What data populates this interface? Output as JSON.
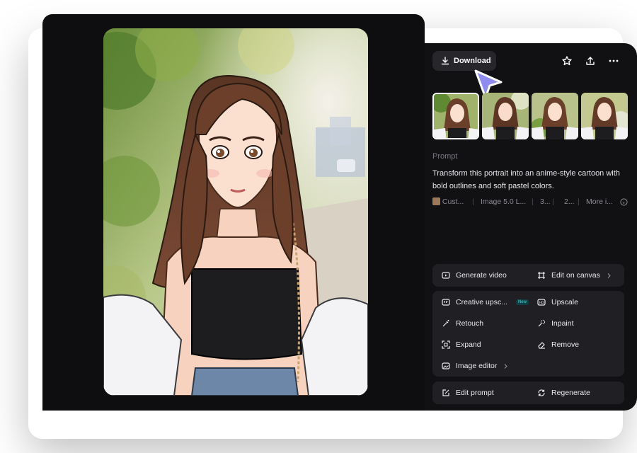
{
  "toolbar": {
    "download_label": "Download",
    "icons": [
      "download-icon",
      "star-icon",
      "share-icon",
      "more-icon"
    ]
  },
  "thumbnails": {
    "count": 4,
    "selected_index": 0
  },
  "prompt": {
    "label": "Prompt",
    "text": "Transform this portrait into an anime-style cartoon with bold outlines and soft pastel colors.",
    "meta": [
      "Cust...",
      "Image 5.0 L...",
      "3...",
      "2...",
      "More i..."
    ]
  },
  "actions": {
    "group1": [
      {
        "label": "Generate video",
        "icon": "video-icon"
      },
      {
        "label": "Edit on canvas",
        "icon": "canvas-icon"
      }
    ],
    "group2": [
      {
        "label": "Creative upsc...",
        "icon": "creative-upscale-icon",
        "badge": "New"
      },
      {
        "label": "Upscale",
        "icon": "upscale-icon"
      },
      {
        "label": "Retouch",
        "icon": "retouch-icon"
      },
      {
        "label": "Inpaint",
        "icon": "inpaint-icon"
      },
      {
        "label": "Expand",
        "icon": "expand-icon"
      },
      {
        "label": "Remove",
        "icon": "eraser-icon"
      },
      {
        "label": "Image editor",
        "icon": "image-editor-icon"
      }
    ],
    "group3": [
      {
        "label": "Edit prompt",
        "icon": "edit-prompt-icon"
      },
      {
        "label": "Regenerate",
        "icon": "regenerate-icon"
      }
    ]
  },
  "colors": {
    "panel": "#111114",
    "button": "#26262b",
    "accent_cursor": "#8f8cf0"
  }
}
